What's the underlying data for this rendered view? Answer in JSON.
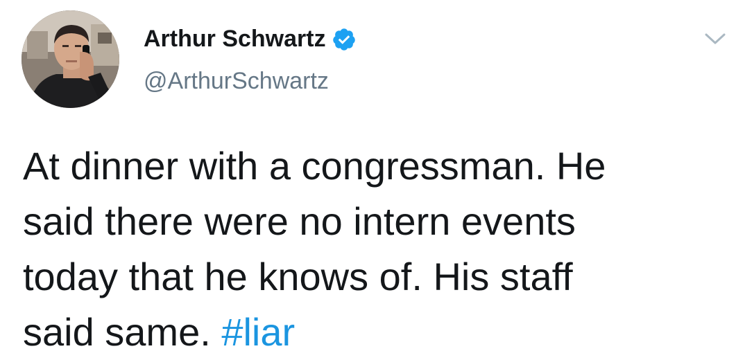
{
  "author": {
    "display_name": "Arthur Schwartz",
    "handle": "@ArthurSchwartz",
    "verified": true,
    "avatar": "profile-photo-man-on-phone"
  },
  "tweet": {
    "lines": [
      "At dinner with a congressman. He",
      "said there were no intern events",
      "today that he knows of. His staff",
      "said same. "
    ],
    "hashtag": "#liar"
  },
  "icons": {
    "verified": "verified-badge-icon",
    "menu": "chevron-down-icon"
  },
  "colors": {
    "text": "#14171a",
    "secondary": "#657786",
    "link": "#1b95e0",
    "verified": "#1da1f2"
  }
}
